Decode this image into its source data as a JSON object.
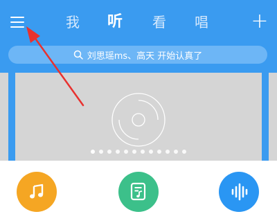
{
  "topbar": {
    "tabs": [
      {
        "label": "我",
        "active": false
      },
      {
        "label": "听",
        "active": true
      },
      {
        "label": "看",
        "active": false
      },
      {
        "label": "唱",
        "active": false
      }
    ],
    "add_label": "+"
  },
  "search": {
    "placeholder": "刘思瑶ms、高天 开始认真了"
  },
  "banner": {
    "dot_count": 12,
    "active_dot": 0
  },
  "shortcuts": [
    {
      "icon": "music-note-icon",
      "color": "#f5a623"
    },
    {
      "icon": "song-list-icon",
      "color": "#3cc08a"
    },
    {
      "icon": "sound-wave-icon",
      "color": "#2a96f3"
    }
  ],
  "colors": {
    "header": "#3a9bf0",
    "annotation_arrow": "#e8312f"
  }
}
